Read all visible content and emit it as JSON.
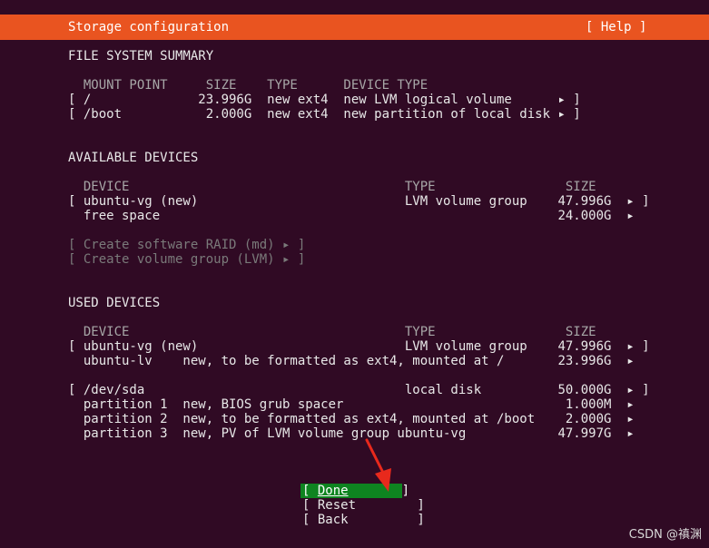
{
  "header": {
    "title": "Storage configuration",
    "help": "[ Help ]"
  },
  "summary": {
    "heading": "FILE SYSTEM SUMMARY",
    "columns": "  MOUNT POINT     SIZE    TYPE      DEVICE TYPE",
    "rows": [
      "[ /              23.996G  new ext4  new LVM logical volume      ▸ ]",
      "[ /boot           2.000G  new ext4  new partition of local disk ▸ ]"
    ]
  },
  "available": {
    "heading": "AVAILABLE DEVICES",
    "columns": "  DEVICE                                    TYPE                 SIZE",
    "rows": [
      "[ ubuntu-vg (new)                           LVM volume group    47.996G  ▸ ]",
      "  free space                                                    24.000G  ▸"
    ],
    "actions": [
      "[ Create software RAID (md) ▸ ]",
      "[ Create volume group (LVM) ▸ ]"
    ]
  },
  "used": {
    "heading": "USED DEVICES",
    "columns": "  DEVICE                                    TYPE                 SIZE",
    "rows": [
      "[ ubuntu-vg (new)                           LVM volume group    47.996G  ▸ ]",
      "  ubuntu-lv    new, to be formatted as ext4, mounted at /       23.996G  ▸",
      "[ /dev/sda                                  local disk          50.000G  ▸ ]",
      "  partition 1  new, BIOS grub spacer                             1.000M  ▸",
      "  partition 2  new, to be formatted as ext4, mounted at /boot    2.000G  ▸",
      "  partition 3  new, PV of LVM volume group ubuntu-vg            47.997G  ▸"
    ]
  },
  "buttons": {
    "done_open": "[ ",
    "done_label": "Done",
    "done_close": "       ]",
    "reset": "[ Reset        ]",
    "back": "[ Back         ]"
  },
  "watermark": "CSDN @禛渊",
  "colors": {
    "accent": "#e95420",
    "selected_button": "#0e8420",
    "background": "#300a24",
    "annotation_arrow": "#e8291c"
  }
}
